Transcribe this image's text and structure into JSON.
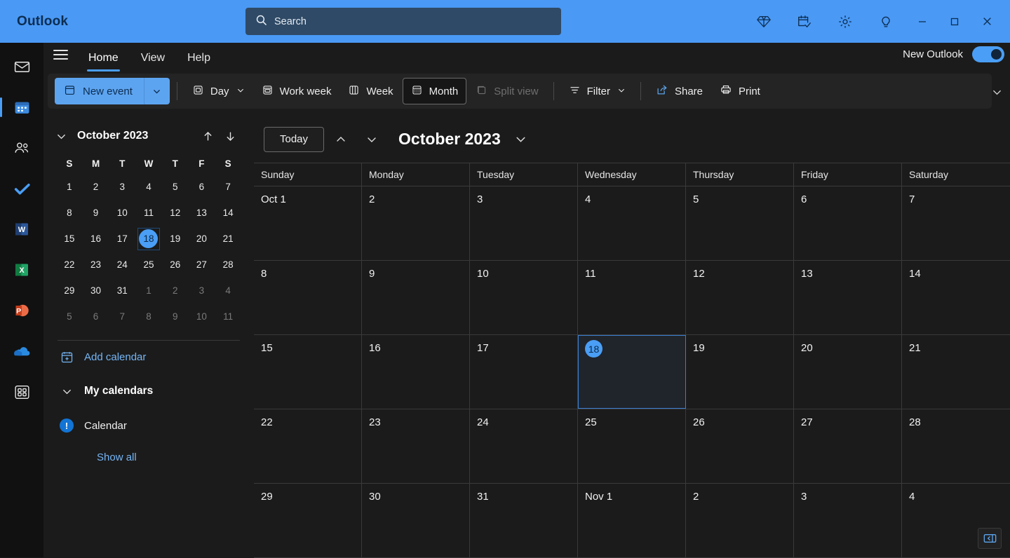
{
  "titlebar": {
    "app_title": "Outlook",
    "search": {
      "placeholder": "Search",
      "value": "",
      "icon": "search-icon"
    },
    "icons": [
      {
        "name": "premium-diamond-icon",
        "label": "Microsoft 365 premium"
      },
      {
        "name": "calendar-check-icon",
        "label": "To Do / Calendar"
      },
      {
        "name": "gear-icon",
        "label": "Settings"
      },
      {
        "name": "lightbulb-icon",
        "label": "Tips"
      }
    ],
    "window_controls": [
      {
        "name": "minimize-button",
        "label": "Minimize"
      },
      {
        "name": "maximize-button",
        "label": "Maximize"
      },
      {
        "name": "close-button",
        "label": "Close"
      }
    ],
    "accent_color": "#4a99f5",
    "search_bg": "#2f4a66"
  },
  "rail": {
    "items": [
      {
        "name": "rail-mail",
        "label": "Mail",
        "active": false
      },
      {
        "name": "rail-calendar",
        "label": "Calendar",
        "active": true
      },
      {
        "name": "rail-people",
        "label": "People",
        "active": false
      },
      {
        "name": "rail-todo",
        "label": "To Do",
        "active": false
      },
      {
        "name": "rail-word",
        "label": "Word",
        "active": false
      },
      {
        "name": "rail-excel",
        "label": "Excel",
        "active": false
      },
      {
        "name": "rail-powerpoint",
        "label": "PowerPoint",
        "active": false
      },
      {
        "name": "rail-onedrive",
        "label": "OneDrive",
        "active": false
      },
      {
        "name": "rail-apps",
        "label": "More apps",
        "active": false
      }
    ]
  },
  "ribbon": {
    "tabs": [
      {
        "label": "Home",
        "active": true
      },
      {
        "label": "View",
        "active": false
      },
      {
        "label": "Help",
        "active": false
      }
    ],
    "new_outlook": {
      "label": "New Outlook",
      "toggle_on": true
    },
    "commands": {
      "new_event": "New event",
      "day": "Day",
      "work_week": "Work week",
      "week": "Week",
      "month": "Month",
      "split_view": "Split view",
      "filter": "Filter",
      "share": "Share",
      "print": "Print"
    },
    "selected_view": "Month",
    "disabled": [
      "Split view"
    ]
  },
  "sidepane": {
    "mini_calendar": {
      "title": "October 2023",
      "dow": [
        "S",
        "M",
        "T",
        "W",
        "T",
        "F",
        "S"
      ],
      "weeks": [
        [
          {
            "d": "1"
          },
          {
            "d": "2"
          },
          {
            "d": "3"
          },
          {
            "d": "4"
          },
          {
            "d": "5"
          },
          {
            "d": "6"
          },
          {
            "d": "7"
          }
        ],
        [
          {
            "d": "8"
          },
          {
            "d": "9"
          },
          {
            "d": "10"
          },
          {
            "d": "11"
          },
          {
            "d": "12"
          },
          {
            "d": "13"
          },
          {
            "d": "14"
          }
        ],
        [
          {
            "d": "15"
          },
          {
            "d": "16"
          },
          {
            "d": "17"
          },
          {
            "d": "18",
            "today": true
          },
          {
            "d": "19"
          },
          {
            "d": "20"
          },
          {
            "d": "21"
          }
        ],
        [
          {
            "d": "22"
          },
          {
            "d": "23"
          },
          {
            "d": "24"
          },
          {
            "d": "25"
          },
          {
            "d": "26"
          },
          {
            "d": "27"
          },
          {
            "d": "28"
          }
        ],
        [
          {
            "d": "29"
          },
          {
            "d": "30"
          },
          {
            "d": "31"
          },
          {
            "d": "1",
            "out": true
          },
          {
            "d": "2",
            "out": true
          },
          {
            "d": "3",
            "out": true
          },
          {
            "d": "4",
            "out": true
          }
        ],
        [
          {
            "d": "5",
            "out": true
          },
          {
            "d": "6",
            "out": true
          },
          {
            "d": "7",
            "out": true
          },
          {
            "d": "8",
            "out": true
          },
          {
            "d": "9",
            "out": true
          },
          {
            "d": "10",
            "out": true
          },
          {
            "d": "11",
            "out": true
          }
        ]
      ]
    },
    "add_calendar": "Add calendar",
    "my_calendars": "My calendars",
    "calendar_item": "Calendar",
    "show_all": "Show all"
  },
  "calendar": {
    "today_button": "Today",
    "month_title": "October 2023",
    "day_headers": [
      "Sunday",
      "Monday",
      "Tuesday",
      "Wednesday",
      "Thursday",
      "Friday",
      "Saturday"
    ],
    "weeks": [
      [
        {
          "n": "Oct 1"
        },
        {
          "n": "2"
        },
        {
          "n": "3"
        },
        {
          "n": "4"
        },
        {
          "n": "5"
        },
        {
          "n": "6"
        },
        {
          "n": "7"
        }
      ],
      [
        {
          "n": "8"
        },
        {
          "n": "9"
        },
        {
          "n": "10"
        },
        {
          "n": "11"
        },
        {
          "n": "12"
        },
        {
          "n": "13"
        },
        {
          "n": "14"
        }
      ],
      [
        {
          "n": "15"
        },
        {
          "n": "16"
        },
        {
          "n": "17"
        },
        {
          "n": "18",
          "today": true
        },
        {
          "n": "19"
        },
        {
          "n": "20"
        },
        {
          "n": "21"
        }
      ],
      [
        {
          "n": "22"
        },
        {
          "n": "23"
        },
        {
          "n": "24"
        },
        {
          "n": "25"
        },
        {
          "n": "26"
        },
        {
          "n": "27"
        },
        {
          "n": "28"
        }
      ],
      [
        {
          "n": "29"
        },
        {
          "n": "30"
        },
        {
          "n": "31"
        },
        {
          "n": "Nov 1"
        },
        {
          "n": "2"
        },
        {
          "n": "3"
        },
        {
          "n": "4"
        }
      ]
    ],
    "events": [],
    "panel_expand_icon": "panel-expand-icon"
  }
}
